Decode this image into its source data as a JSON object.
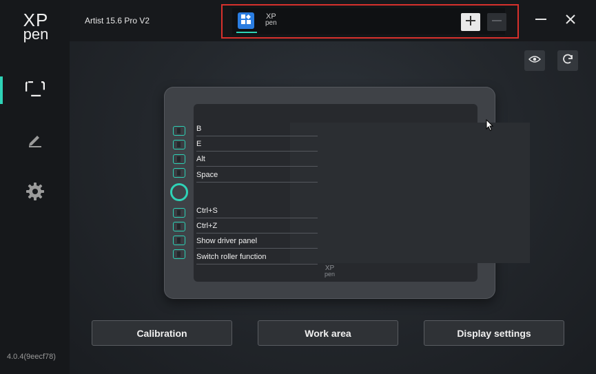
{
  "logo": {
    "line1": "XP",
    "line2": "pen"
  },
  "sidebar": {
    "items": [
      {
        "name": "work-area",
        "icon": "fullscreen-icon",
        "active": true
      },
      {
        "name": "pen-settings",
        "icon": "pen-icon",
        "active": false
      },
      {
        "name": "settings",
        "icon": "gear-icon",
        "active": false
      }
    ],
    "version": "4.0.4(9eecf78)"
  },
  "titlebar": {
    "device_name": "Artist 15.6 Pro V2",
    "tab_app_icon": "apps-icon",
    "tab_logo": {
      "line1": "XP",
      "line2": "pen"
    },
    "add_label": "+",
    "remove_label": "—",
    "minimize_icon": "minimize-icon",
    "close_icon": "close-icon"
  },
  "toolbar": {
    "view_icon": "eye-icon",
    "refresh_icon": "refresh-icon"
  },
  "tablet": {
    "keys_top": [
      "B",
      "E",
      "Alt",
      "Space"
    ],
    "keys_bottom": [
      "Ctrl+S",
      "Ctrl+Z",
      "Show driver panel",
      "Switch roller function"
    ],
    "screen_logo": {
      "line1": "XP",
      "line2": "pen"
    }
  },
  "buttons": {
    "calibration": "Calibration",
    "work_area": "Work area",
    "display_settings": "Display settings"
  },
  "colors": {
    "accent": "#2ed3b7",
    "highlight_border": "#d9312c",
    "app_icon": "#2a7de1"
  }
}
